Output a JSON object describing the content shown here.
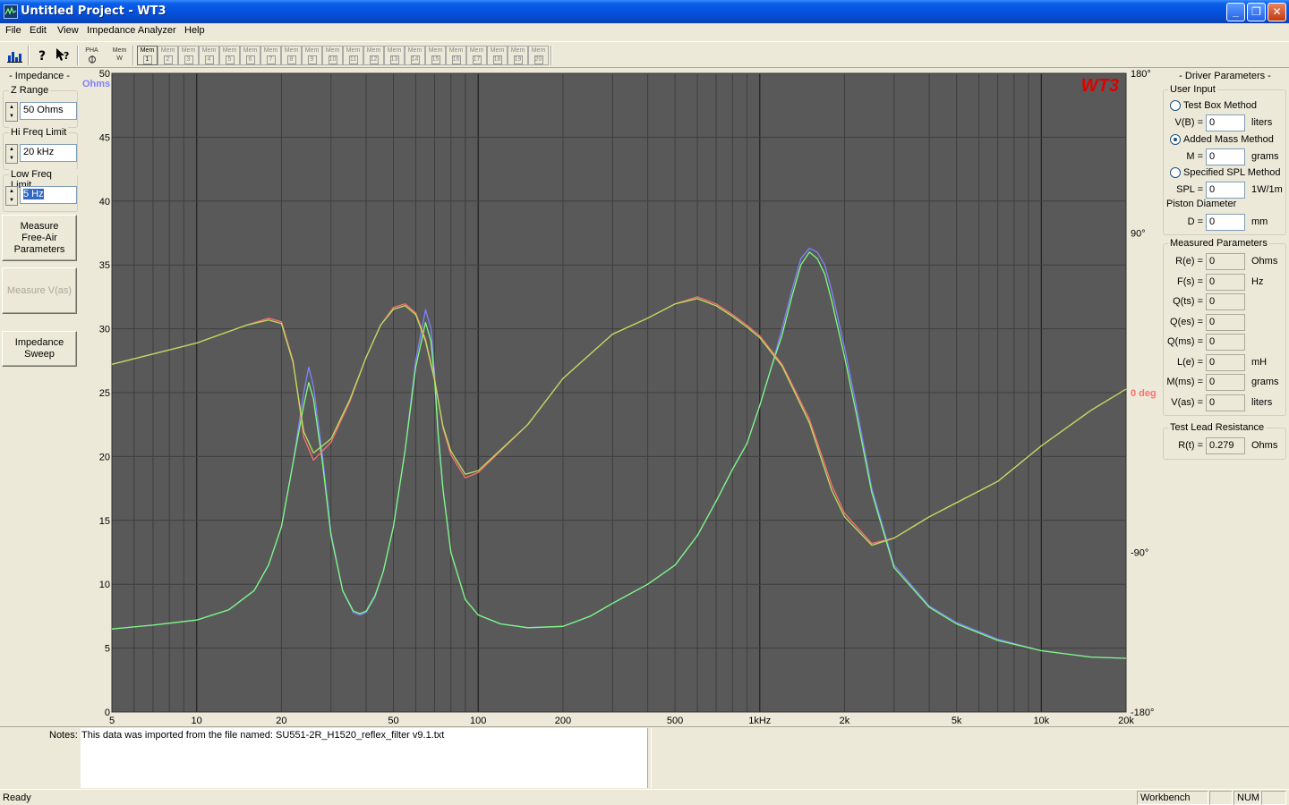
{
  "window": {
    "title": "Untitled Project - WT3",
    "controls": {
      "minimize": "_",
      "maximize": "❐",
      "close": "✕"
    }
  },
  "menu": [
    "File",
    "Edit",
    "View",
    "Impedance Analyzer",
    "Help"
  ],
  "toolbar": {
    "pha_label": "PHA",
    "mem_w_top": "Mem",
    "mem_w_bottom": "W",
    "mem_label": "Mem",
    "mem_slots": [
      "1",
      "2",
      "3",
      "4",
      "5",
      "6",
      "7",
      "8",
      "9",
      "10",
      "11",
      "12",
      "13",
      "14",
      "15",
      "16",
      "17",
      "18",
      "19",
      "20"
    ],
    "active_mem": "1"
  },
  "left_panel": {
    "title": "- Impedance -",
    "z_range": {
      "label": "Z Range",
      "value": "50 Ohms"
    },
    "hi_freq": {
      "label": "Hi Freq Limit",
      "value": "20 kHz"
    },
    "low_freq": {
      "label": "Low Freq Limit",
      "value": "5 Hz"
    },
    "measure_free_air": "Measure Free-Air Parameters",
    "measure_vas": "Measure V(as)",
    "impedance_sweep": "Impedance Sweep"
  },
  "right_panel": {
    "title": "- Driver Parameters -",
    "user_input": {
      "legend": "User Input",
      "methods": [
        {
          "label": "Test Box Method",
          "selected": false,
          "field": "V(B) =",
          "value": "0",
          "unit": "liters"
        },
        {
          "label": "Added Mass Method",
          "selected": true,
          "field": "M =",
          "value": "0",
          "unit": "grams"
        },
        {
          "label": "Specified SPL Method",
          "selected": false,
          "field": "SPL =",
          "value": "0",
          "unit": "1W/1m"
        }
      ],
      "piston_label": "Piston Diameter",
      "piston": {
        "field": "D =",
        "value": "0",
        "unit": "mm"
      }
    },
    "measured": {
      "legend": "Measured Parameters",
      "rows": [
        {
          "field": "R(e) =",
          "value": "0",
          "unit": "Ohms"
        },
        {
          "field": "F(s) =",
          "value": "0",
          "unit": "Hz"
        },
        {
          "field": "Q(ts) =",
          "value": "0",
          "unit": ""
        },
        {
          "field": "Q(es) =",
          "value": "0",
          "unit": ""
        },
        {
          "field": "Q(ms) =",
          "value": "0",
          "unit": ""
        },
        {
          "field": "L(e) =",
          "value": "0",
          "unit": "mH"
        },
        {
          "field": "M(ms) =",
          "value": "0",
          "unit": "grams"
        },
        {
          "field": "V(as) =",
          "value": "0",
          "unit": "liters"
        }
      ]
    },
    "lead": {
      "legend": "Test Lead Resistance",
      "field": "R(t) =",
      "value": "0.279",
      "unit": "Ohms"
    }
  },
  "notes": {
    "label": "Notes:",
    "text": "This data was imported from the file named:  SU551-2R_H1520_reflex_filter v9.1.txt"
  },
  "status": {
    "ready": "Ready",
    "panes": [
      "Workbench",
      "",
      "NUM",
      ""
    ]
  },
  "chart_data": {
    "type": "line",
    "logo": "WT3",
    "y_unit_label": "Ohms",
    "phase_unit_label": "0 deg",
    "xscale": "log",
    "xlim": [
      5,
      20000
    ],
    "ylim": [
      0,
      50
    ],
    "phase_lim": [
      -180,
      180
    ],
    "x_ticks": [
      5,
      10,
      20,
      50,
      100,
      200,
      500,
      1000,
      2000,
      5000,
      10000,
      20000
    ],
    "x_tick_labels": [
      "5",
      "10",
      "20",
      "50",
      "100",
      "200",
      "500",
      "1kHz",
      "2k",
      "5k",
      "10k",
      "20k"
    ],
    "y_ticks": [
      0,
      5,
      10,
      15,
      20,
      25,
      30,
      35,
      40,
      45,
      50
    ],
    "phase_ticks": [
      180,
      90,
      -90,
      -180
    ],
    "phase_tick_labels": [
      "180°",
      "90°",
      "-90°",
      "-180°"
    ],
    "grid": true,
    "colors": {
      "background": "#595959",
      "impedance_1": "#8080FF",
      "impedance_2": "#7CFC7C",
      "phase_1": "#FF7070",
      "phase_2": "#B8E060",
      "logo": "#E00000",
      "ohms_label": "#8080FF",
      "deg_label": "#FF7070"
    },
    "series": [
      {
        "kind": "impedance",
        "color_key": "impedance_1",
        "x": [
          5,
          7,
          10,
          13,
          16,
          18,
          20,
          22,
          24,
          25,
          26,
          28,
          30,
          33,
          36,
          38,
          40,
          43,
          46,
          50,
          55,
          60,
          65,
          68,
          70,
          72,
          75,
          80,
          90,
          100,
          120,
          150,
          200,
          250,
          300,
          400,
          500,
          600,
          700,
          800,
          900,
          1000,
          1100,
          1200,
          1300,
          1400,
          1500,
          1600,
          1700,
          1800,
          2000,
          2200,
          2500,
          3000,
          4000,
          5000,
          7000,
          10000,
          15000,
          20000
        ],
        "y": [
          6.5,
          6.8,
          7.2,
          8.0,
          9.5,
          11.5,
          14.5,
          19.5,
          25.0,
          27.0,
          25.5,
          20.0,
          14.0,
          9.5,
          7.8,
          7.6,
          7.8,
          9.0,
          11.0,
          14.5,
          20.5,
          27.5,
          31.5,
          30.0,
          26.5,
          22.0,
          17.5,
          12.5,
          8.8,
          7.6,
          6.9,
          6.6,
          6.7,
          7.5,
          8.5,
          10.0,
          11.5,
          13.8,
          16.5,
          19.0,
          21.0,
          24.0,
          27.0,
          30.0,
          33.0,
          35.5,
          36.3,
          36.0,
          35.0,
          33.0,
          28.5,
          24.0,
          17.5,
          11.5,
          8.3,
          7.0,
          5.7,
          4.8,
          4.3,
          4.2
        ]
      },
      {
        "kind": "impedance",
        "color_key": "impedance_2",
        "x": [
          5,
          7,
          10,
          13,
          16,
          18,
          20,
          22,
          24,
          25,
          26,
          28,
          30,
          33,
          36,
          38,
          40,
          43,
          46,
          50,
          55,
          60,
          65,
          68,
          70,
          72,
          75,
          80,
          90,
          100,
          120,
          150,
          200,
          250,
          300,
          400,
          500,
          600,
          700,
          800,
          900,
          1000,
          1100,
          1200,
          1300,
          1400,
          1500,
          1600,
          1700,
          1800,
          2000,
          2200,
          2500,
          3000,
          4000,
          5000,
          7000,
          10000,
          15000,
          20000
        ],
        "y": [
          6.5,
          6.8,
          7.2,
          8.0,
          9.5,
          11.5,
          14.5,
          19.5,
          24.0,
          25.8,
          24.5,
          19.5,
          13.8,
          9.5,
          7.9,
          7.7,
          7.9,
          9.1,
          11.0,
          14.5,
          20.5,
          27.0,
          30.5,
          29.0,
          26.0,
          21.8,
          17.4,
          12.5,
          8.8,
          7.6,
          6.9,
          6.6,
          6.7,
          7.5,
          8.5,
          10.0,
          11.5,
          13.8,
          16.5,
          19.0,
          21.0,
          24.0,
          27.0,
          29.5,
          32.5,
          35.0,
          36.0,
          35.5,
          34.3,
          32.2,
          27.8,
          23.4,
          17.2,
          11.3,
          8.2,
          6.9,
          5.6,
          4.8,
          4.3,
          4.2
        ]
      },
      {
        "kind": "phase",
        "color_key": "phase_1",
        "x": [
          5,
          10,
          15,
          18,
          20,
          22,
          24,
          26,
          30,
          35,
          40,
          45,
          50,
          55,
          60,
          65,
          70,
          75,
          80,
          90,
          100,
          150,
          200,
          300,
          400,
          500,
          600,
          700,
          800,
          900,
          1000,
          1200,
          1500,
          1800,
          2000,
          2500,
          3000,
          4000,
          5000,
          7000,
          10000,
          15000,
          20000
        ],
        "y": [
          16,
          28,
          38,
          42,
          40,
          18,
          -25,
          -38,
          -28,
          -5,
          20,
          38,
          48,
          50,
          45,
          30,
          8,
          -20,
          -35,
          -48,
          -45,
          -18,
          8,
          33,
          42,
          50,
          54,
          50,
          44,
          38,
          32,
          16,
          -15,
          -52,
          -68,
          -85,
          -82,
          -70,
          -62,
          -50,
          -30,
          -10,
          2
        ]
      },
      {
        "kind": "phase",
        "color_key": "phase_2",
        "x": [
          5,
          10,
          15,
          18,
          20,
          22,
          24,
          26,
          30,
          35,
          40,
          45,
          50,
          55,
          60,
          65,
          70,
          75,
          80,
          90,
          100,
          150,
          200,
          300,
          400,
          500,
          600,
          700,
          800,
          900,
          1000,
          1200,
          1500,
          1800,
          2000,
          2500,
          3000,
          4000,
          5000,
          7000,
          10000,
          15000,
          20000
        ],
        "y": [
          16,
          28,
          38,
          41,
          39,
          17,
          -22,
          -34,
          -26,
          -4,
          20,
          38,
          47,
          49,
          44,
          29,
          7,
          -19,
          -33,
          -46,
          -44,
          -18,
          8,
          33,
          42,
          50,
          53,
          49,
          43,
          37,
          31,
          15,
          -17,
          -55,
          -70,
          -86,
          -82,
          -70,
          -62,
          -50,
          -30,
          -10,
          2
        ]
      }
    ]
  }
}
